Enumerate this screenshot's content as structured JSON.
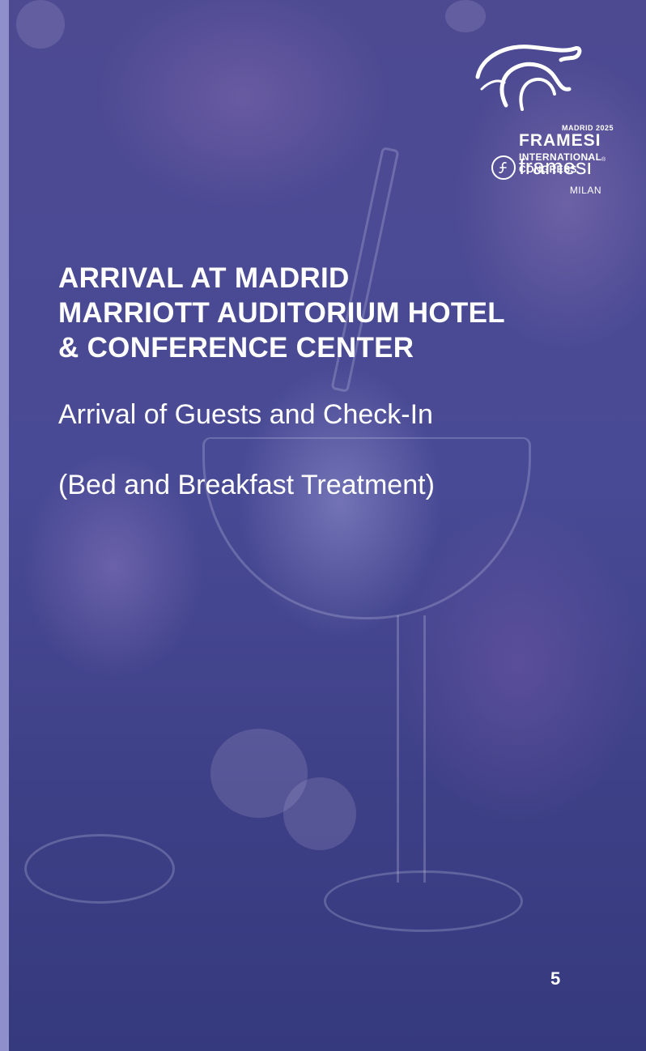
{
  "logo": {
    "year_label": "MADRID 2025",
    "event_name": "FRAMESI",
    "event_sub_line1": "INTERNATIONAL",
    "event_sub_line2": "CONGRESS"
  },
  "brand": {
    "name": "framesi",
    "reg": "®",
    "city": "MILAN"
  },
  "content": {
    "headline_line1": "ARRIVAL AT MADRID",
    "headline_line2": "MARRIOTT AUDITORIUM HOTEL",
    "headline_line3": "& CONFERENCE CENTER",
    "subtitle": "Arrival of Guests and Check-In",
    "treatment": "(Bed and Breakfast Treatment)"
  },
  "page_number": "5",
  "colors": {
    "overlay": "#494a95",
    "left_strip": "#8f8fcc",
    "text": "#ffffff"
  },
  "icons": [
    "bull-logo-icon",
    "framesi-f-icon"
  ]
}
